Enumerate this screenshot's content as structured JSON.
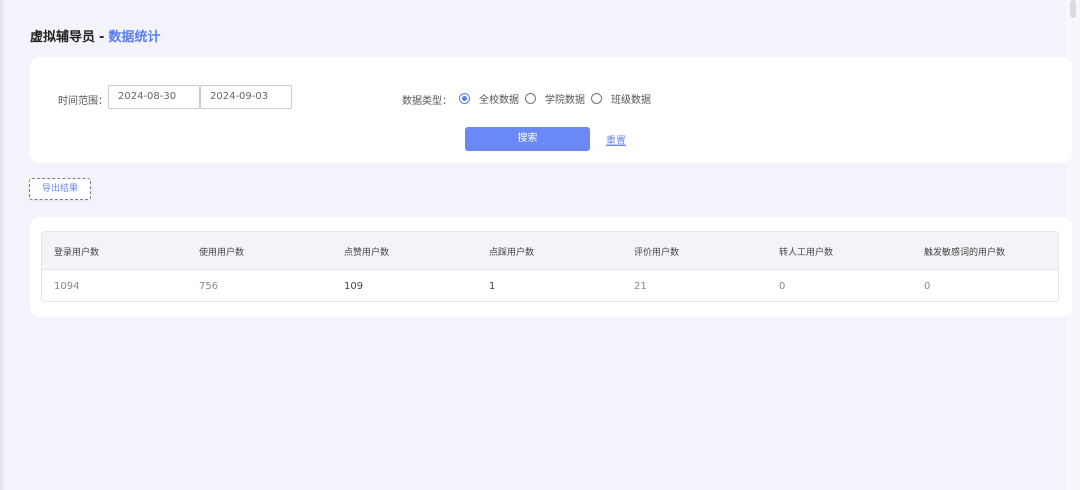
{
  "header": {
    "app_name": "虚拟辅导员",
    "separator": "-",
    "section_name": "数据统计"
  },
  "filters": {
    "date_range_label": "时间范围：",
    "start_date": "2024-08-30",
    "end_date": "2024-09-03",
    "data_type_label": "数据类型：",
    "data_type_options": [
      {
        "label": "全校数据",
        "checked": true
      },
      {
        "label": "学院数据",
        "checked": false
      },
      {
        "label": "班级数据",
        "checked": false
      }
    ],
    "search_label": "搜索",
    "reset_label": "重置"
  },
  "actions": {
    "export_label": "导出结果"
  },
  "table": {
    "columns": [
      "登录用户数",
      "使用用户数",
      "点赞用户数",
      "点踩用户数",
      "评价用户数",
      "转人工用户数",
      "触发敏感词的用户数"
    ],
    "rows": [
      [
        "1094",
        "756",
        "109",
        "1",
        "21",
        "0",
        "0"
      ]
    ]
  },
  "colors": {
    "accent": "#5b7cf0",
    "background": "#f3f4fb",
    "card": "#ffffff"
  }
}
